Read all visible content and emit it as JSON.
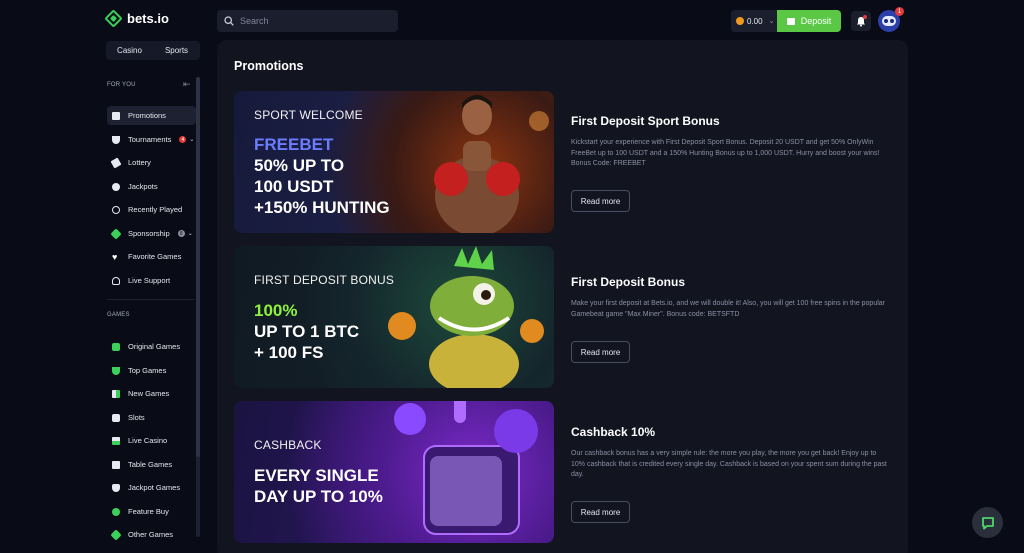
{
  "header": {
    "logo_text": "bets.io",
    "search_placeholder": "Search",
    "balance": "0.00",
    "deposit_label": "Deposit",
    "avatar_badge": "1"
  },
  "sidebar": {
    "tabs": [
      "Casino",
      "Sports"
    ],
    "section_for_you": "FOR YOU",
    "for_you_items": [
      {
        "label": "Promotions",
        "icon": "gift-icon"
      },
      {
        "label": "Tournaments",
        "icon": "trophy-icon",
        "badge": "4"
      },
      {
        "label": "Lottery",
        "icon": "ticket-icon"
      },
      {
        "label": "Jackpots",
        "icon": "jackpot-icon"
      },
      {
        "label": "Recently Played",
        "icon": "clock-icon"
      },
      {
        "label": "Sponsorship",
        "icon": "handshake-icon",
        "badge": "8"
      },
      {
        "label": "Favorite Games",
        "icon": "heart-icon"
      },
      {
        "label": "Live Support",
        "icon": "headset-icon"
      }
    ],
    "section_games": "GAMES",
    "games_items": [
      {
        "label": "Original Games",
        "icon": "original-games-icon"
      },
      {
        "label": "Top Games",
        "icon": "top-games-icon"
      },
      {
        "label": "New Games",
        "icon": "new-games-icon"
      },
      {
        "label": "Slots",
        "icon": "slots-icon"
      },
      {
        "label": "Live Casino",
        "icon": "live-casino-icon"
      },
      {
        "label": "Table Games",
        "icon": "table-games-icon"
      },
      {
        "label": "Jackpot Games",
        "icon": "jackpot-games-icon"
      },
      {
        "label": "Feature Buy",
        "icon": "feature-buy-icon"
      },
      {
        "label": "Other Games",
        "icon": "other-games-icon"
      }
    ]
  },
  "main": {
    "title": "Promotions",
    "promos": [
      {
        "kicker": "SPORT WELCOME",
        "headline": [
          "FREEBET",
          "50% UP TO",
          "100 USDT",
          "+150% HUNTING"
        ],
        "title": "First Deposit Sport Bonus",
        "description": "Kickstart your experience with First Deposit Sport Bonus. Deposit 20 USDT and get 50% OnlyWin FreeBet up to 100 USDT and a 150% Hunting Bonus up to 1,000 USDT. Hurry and boost your wins! Bonus Code: FREEBET",
        "button": "Read more"
      },
      {
        "kicker": "FIRST DEPOSIT BONUS",
        "headline": [
          "100%",
          "UP TO 1 BTC",
          "+ 100 FS"
        ],
        "title": "First Deposit Bonus",
        "description": "Make your first deposit at Bets.io, and we will double it! Also, you will get 100 free spins in the popular Gamebeat game \"Max Miner\". Bonus code: BETSFTD",
        "button": "Read more"
      },
      {
        "kicker": "CASHBACK",
        "headline": [
          "EVERY SINGLE",
          "DAY UP TO 10%"
        ],
        "title": "Cashback 10%",
        "description": "Our cashback bonus has a very simple rule: the more you play, the more you get back! Enjoy up to 10% cashback that is credited every single day. Cashback is based on your spent sum during the past day.",
        "button": "Read more"
      }
    ]
  },
  "colors": {
    "accent": "#5ac844",
    "background": "#090b16",
    "panel": "#121420"
  }
}
